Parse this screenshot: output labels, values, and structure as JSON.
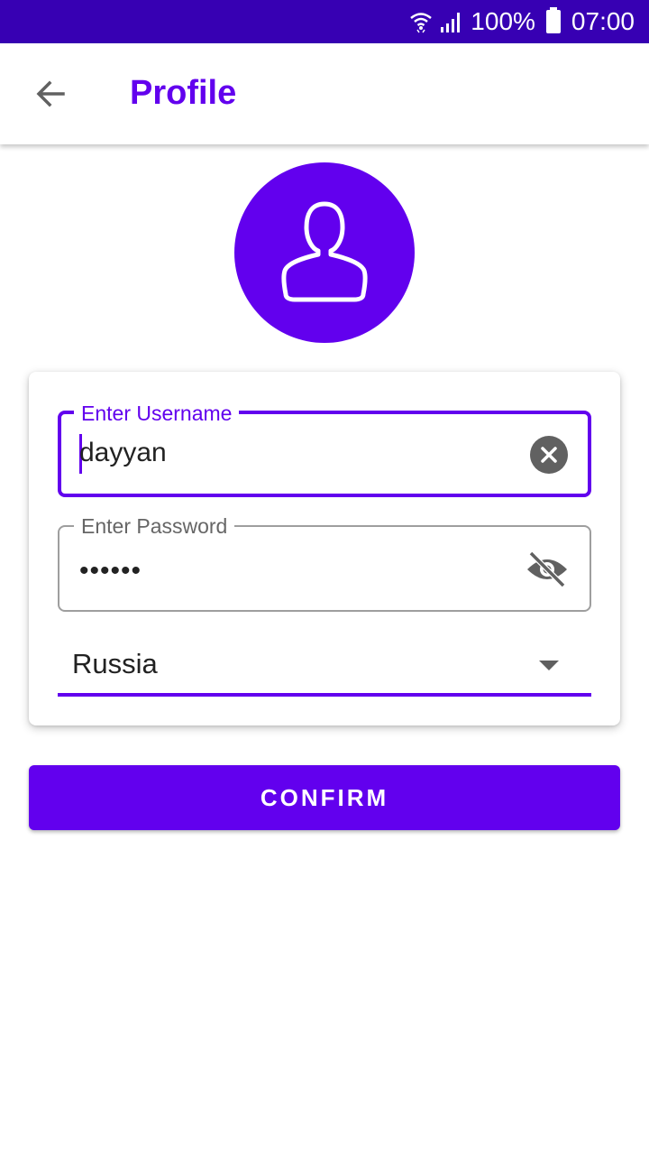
{
  "status_bar": {
    "battery": "100%",
    "time": "07:00",
    "wifi_icon": "wifi-icon",
    "signal_icon": "signal-icon",
    "battery_icon": "battery-icon",
    "background": "#3700b3"
  },
  "app_bar": {
    "title": "Profile",
    "back_icon": "arrow-back-icon",
    "title_color": "#6200ee"
  },
  "avatar": {
    "icon": "person-icon",
    "background": "#6200ee"
  },
  "form": {
    "username": {
      "label": "Enter Username",
      "value": "dayyan",
      "trailing_icon": "clear-icon"
    },
    "password": {
      "label": "Enter Password",
      "value": "••••••",
      "trailing_icon": "visibility-off-icon"
    },
    "country": {
      "selected": "Russia",
      "icon": "dropdown-arrow-icon"
    }
  },
  "confirm_button": {
    "label": "CONFIRM",
    "background": "#6200ee"
  }
}
